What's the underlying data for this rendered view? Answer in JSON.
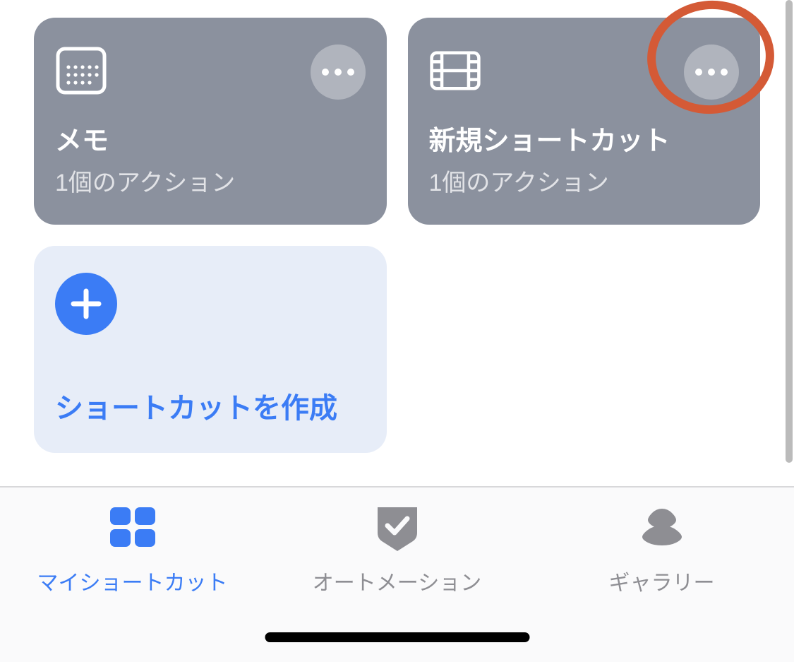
{
  "shortcuts": [
    {
      "title": "メモ",
      "subtitle": "1個のアクション",
      "icon": "calendar"
    },
    {
      "title": "新規ショートカット",
      "subtitle": "1個のアクション",
      "icon": "film"
    }
  ],
  "create": {
    "label": "ショートカットを作成"
  },
  "tabs": {
    "my_shortcuts": "マイショートカット",
    "automation": "オートメーション",
    "gallery": "ギャラリー"
  },
  "colors": {
    "accent": "#3b7cf5",
    "card_bg": "#8b919e",
    "create_bg": "#e7edf8",
    "inactive": "#8e8e93",
    "annotation": "#d45a36"
  }
}
